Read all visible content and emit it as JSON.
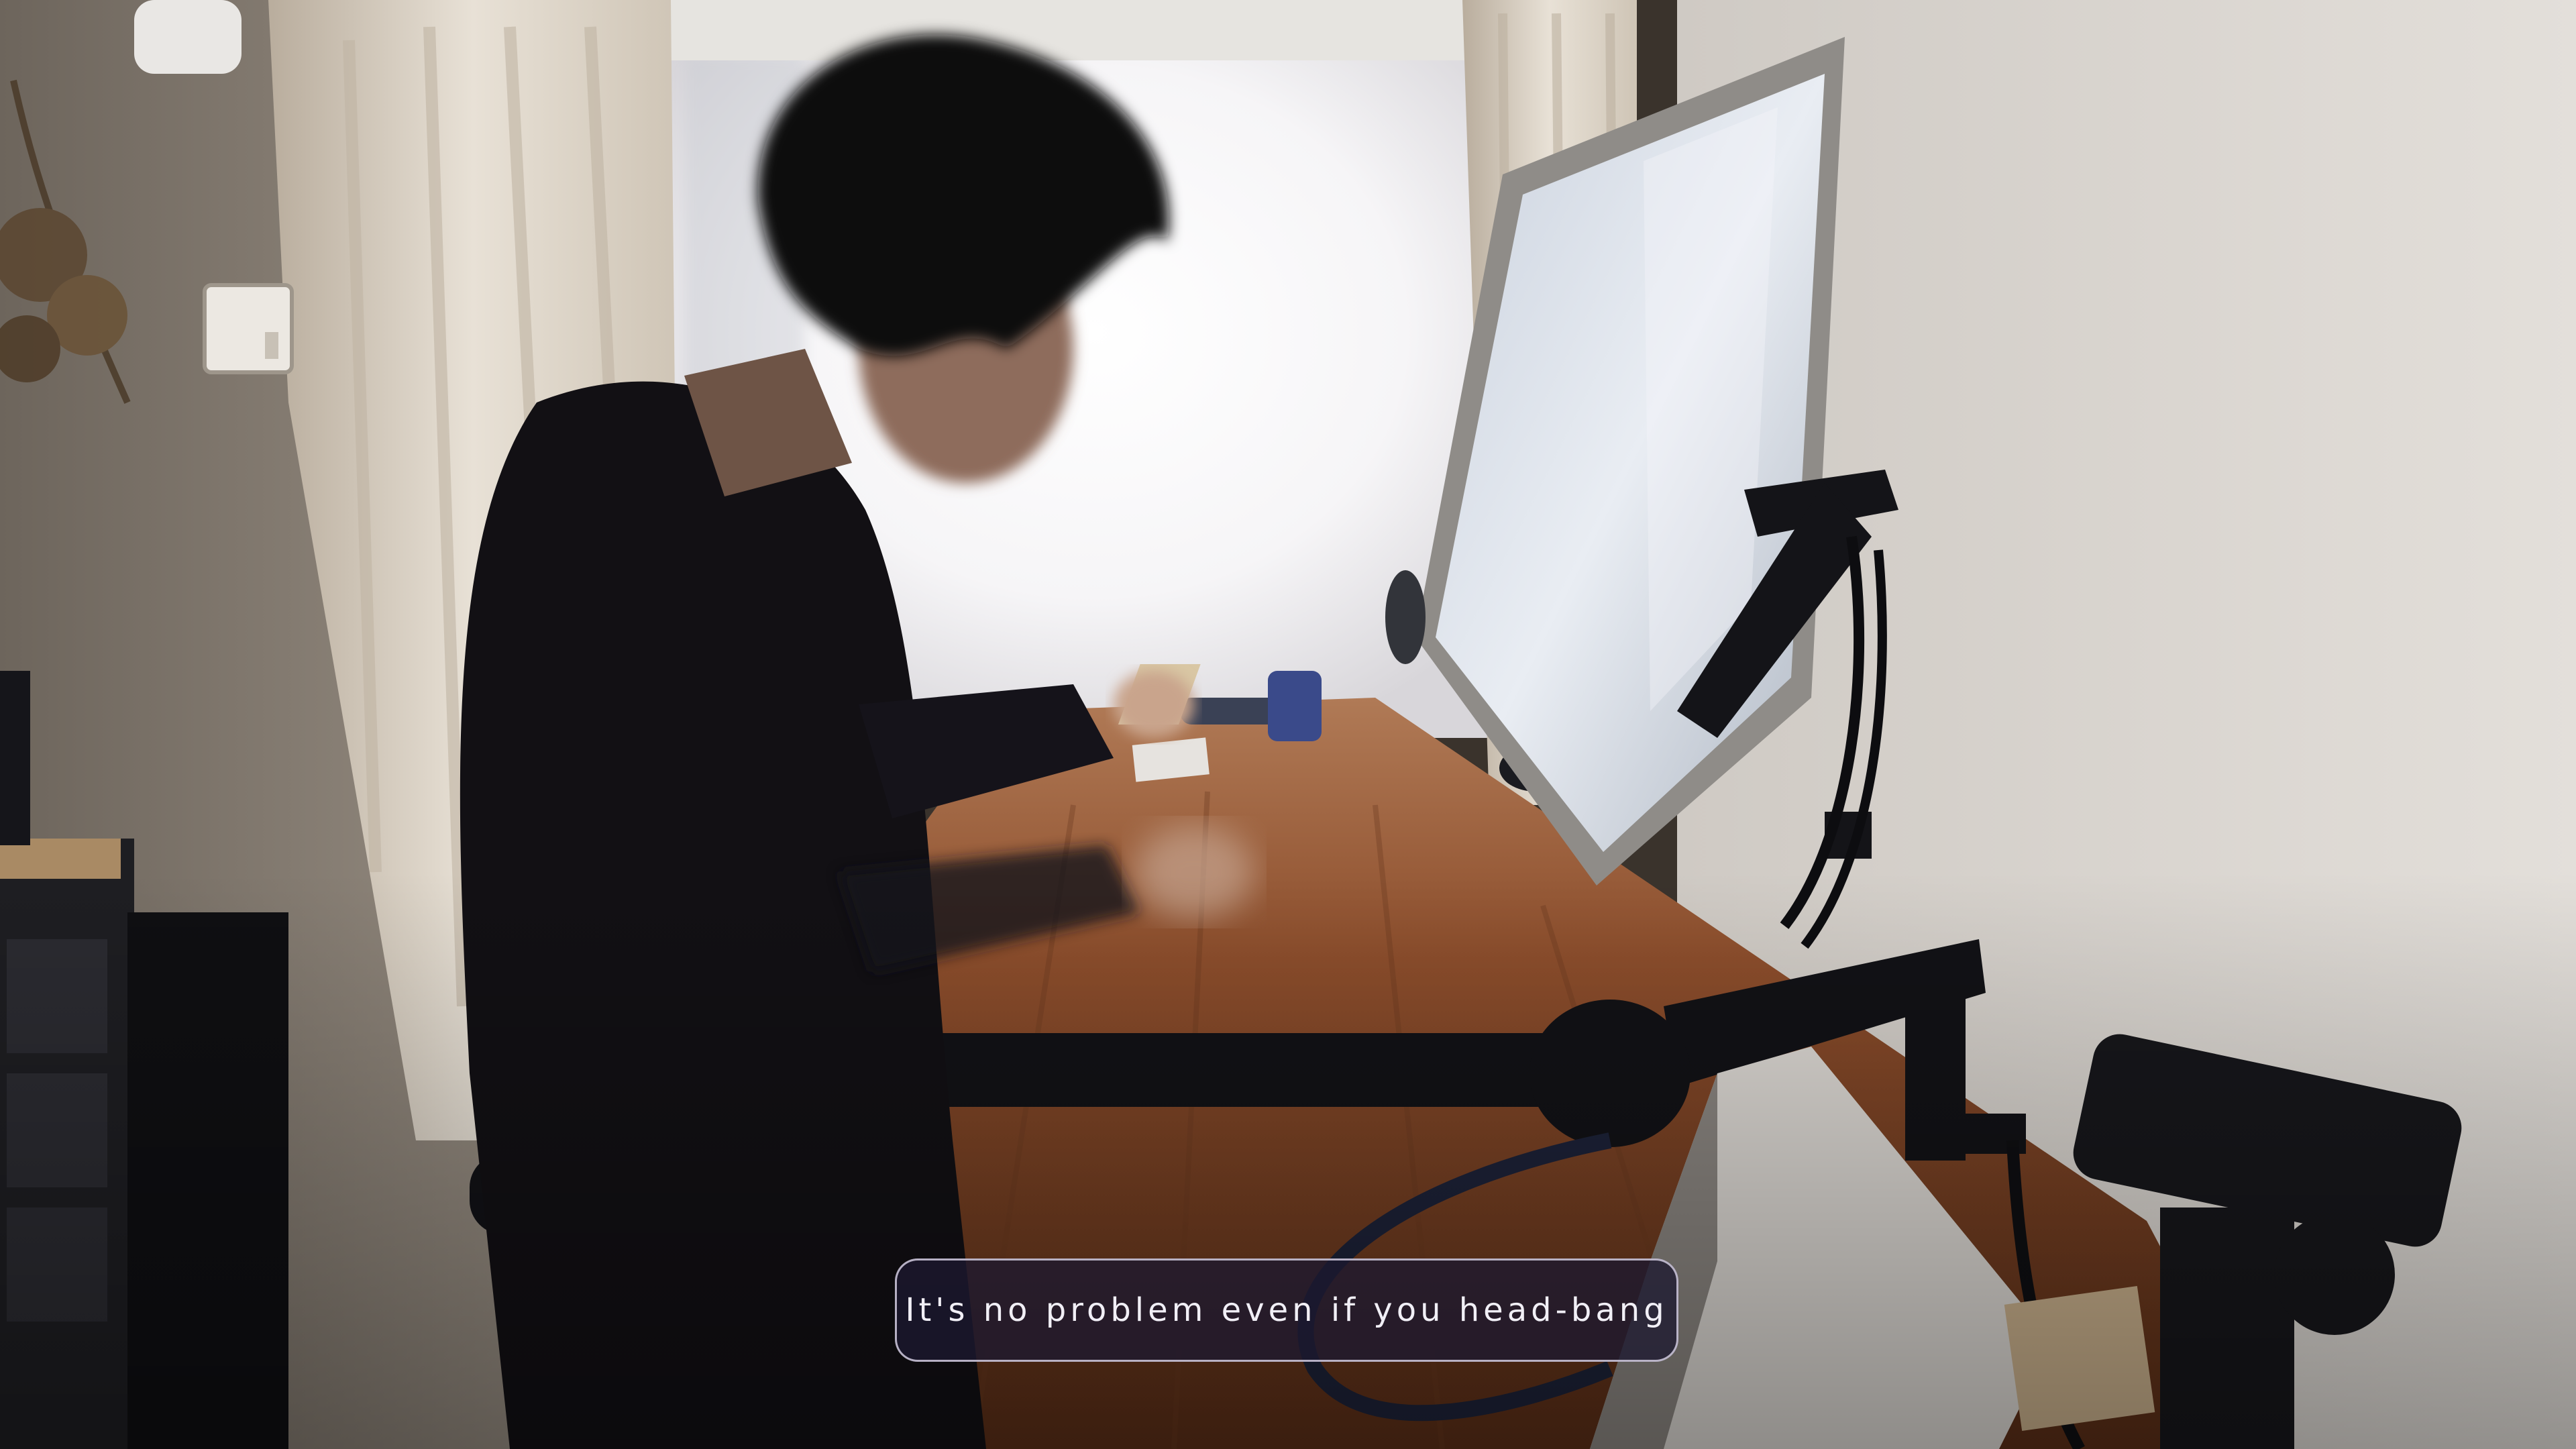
{
  "caption": {
    "text": "It's no problem even if you head-bang"
  },
  "colors": {
    "caption_background": "#1c1830",
    "caption_border": "#d2cde1",
    "caption_text": "#f1eff6",
    "window_light": "#fbfbfd",
    "wall": "#d9d5d0",
    "desk_wood": "#8a4a26",
    "monitor_frame": "#9d9a97",
    "monitor_arm": "#141418",
    "shirt": "#121014",
    "hair": "#0b0c10"
  }
}
